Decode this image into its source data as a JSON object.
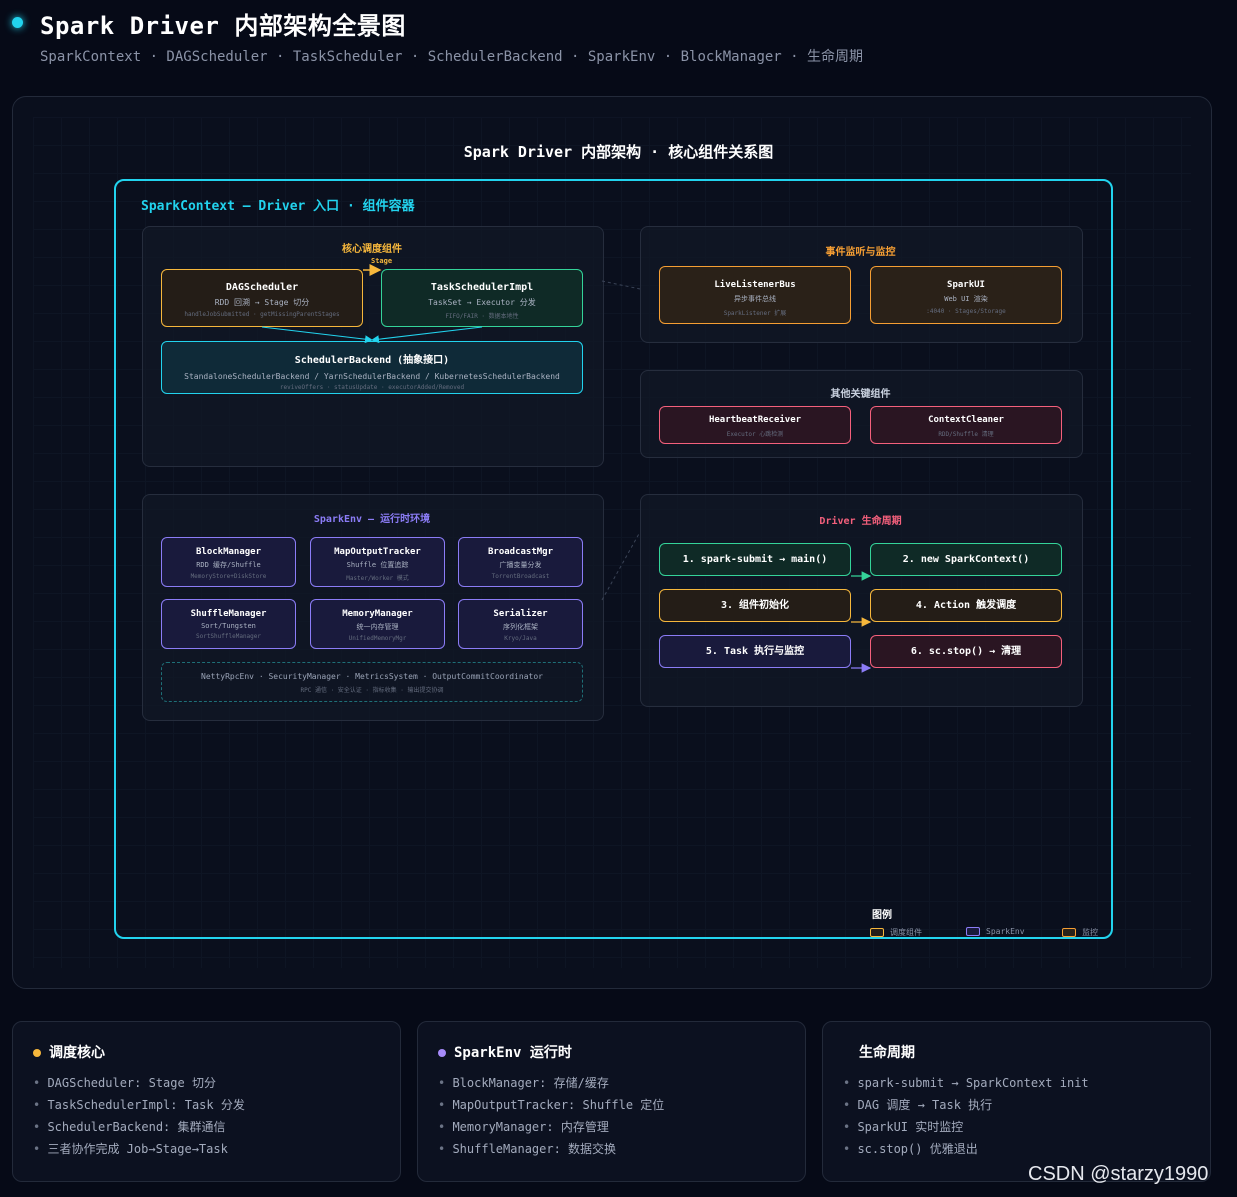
{
  "header": {
    "title": "Spark Driver 内部架构全景图",
    "subtitle": "SparkContext · DAGScheduler · TaskScheduler · SchedulerBackend · SparkEnv · BlockManager · 生命周期"
  },
  "diagram": {
    "title": "Spark Driver 内部架构 · 核心组件关系图",
    "context_title": "SparkContext — Driver 入口 · 组件容器",
    "scheduling": {
      "title": "核心调度组件",
      "edge_label": "Stage",
      "dag": {
        "name": "DAGScheduler",
        "sub": "RDD 回溯 → Stage 切分",
        "foot": "handleJobSubmitted · getMissingParentStages"
      },
      "task": {
        "name": "TaskSchedulerImpl",
        "sub": "TaskSet → Executor 分发",
        "foot": "FIFO/FAIR · 数据本地性"
      },
      "backend": {
        "name": "SchedulerBackend (抽象接口)",
        "sub": "StandaloneSchedulerBackend / YarnSchedulerBackend / KubernetesSchedulerBackend",
        "foot": "reviveOffers · statusUpdate · executorAdded/Removed"
      }
    },
    "events": {
      "title": "事件监听与监控",
      "bus": {
        "name": "LiveListenerBus",
        "sub": "异步事件总线",
        "foot": "SparkListener 扩展"
      },
      "ui": {
        "name": "SparkUI",
        "sub": "Web UI 渲染",
        "foot": ":4040 · Stages/Storage"
      }
    },
    "other": {
      "title": "其他关键组件",
      "heartbeat": {
        "name": "HeartbeatReceiver",
        "foot": "Executor 心跳检测"
      },
      "cleaner": {
        "name": "ContextCleaner",
        "foot": "RDD/Shuffle 清理"
      }
    },
    "sparkenv": {
      "title": "SparkEnv — 运行时环境",
      "block": {
        "name": "BlockManager",
        "sub": "RDD 缓存/Shuffle",
        "foot": "MemoryStore+DiskStore"
      },
      "mapout": {
        "name": "MapOutputTracker",
        "sub": "Shuffle 位置追踪",
        "foot": "Master/Worker 模式"
      },
      "broadcast": {
        "name": "BroadcastMgr",
        "sub": "广播变量分发",
        "foot": "TorrentBroadcast"
      },
      "shuffle": {
        "name": "ShuffleManager",
        "sub": "Sort/Tungsten",
        "foot": "SortShuffleManager"
      },
      "memory": {
        "name": "MemoryManager",
        "sub": "统一内存管理",
        "foot": "UnifiedMemoryMgr"
      },
      "serializer": {
        "name": "Serializer",
        "sub": "序列化框架",
        "foot": "Kryo/Java"
      },
      "misc": {
        "name": "NettyRpcEnv · SecurityManager · MetricsSystem · OutputCommitCoordinator",
        "foot": "RPC 通信 · 安全认证 · 指标收集 · 输出提交协调"
      }
    },
    "lifecycle": {
      "title": "Driver 生命周期",
      "steps": [
        "1. spark-submit → main()",
        "2. new SparkContext()",
        "3. 组件初始化",
        "4. Action 触发调度",
        "5. Task 执行与监控",
        "6. sc.stop() → 清理"
      ]
    },
    "legend": {
      "title": "图例",
      "items": [
        {
          "label": "调度组件",
          "color": "#f6b73c"
        },
        {
          "label": "SparkEnv",
          "color": "#8b7cf6"
        },
        {
          "label": "监控",
          "color": "#f59e33"
        }
      ]
    }
  },
  "cards": [
    {
      "title": "调度核心",
      "dot": "#f6b73c",
      "items": [
        "DAGScheduler: Stage 切分",
        "TaskSchedulerImpl: Task 分发",
        "SchedulerBackend: 集群通信",
        "三者协作完成 Job→Stage→Task"
      ]
    },
    {
      "title": "SparkEnv 运行时",
      "dot": "#a78bfa",
      "items": [
        "BlockManager: 存储/缓存",
        "MapOutputTracker: Shuffle 定位",
        "MemoryManager: 内存管理",
        "ShuffleManager: 数据交换"
      ]
    },
    {
      "title": "生命周期",
      "dot": "",
      "items": [
        "spark-submit → SparkContext init",
        "DAG 调度 → Task 执行",
        "SparkUI 实时监控",
        "sc.stop() 优雅退出"
      ]
    }
  ],
  "watermark": "CSDN @starzy1990",
  "colors": {
    "accent": "#22d3ee",
    "scheduling": "#f6b73c",
    "task": "#34d399",
    "env": "#8b7cf6",
    "event": "#f59e33",
    "keycomp": "#f4607c"
  }
}
